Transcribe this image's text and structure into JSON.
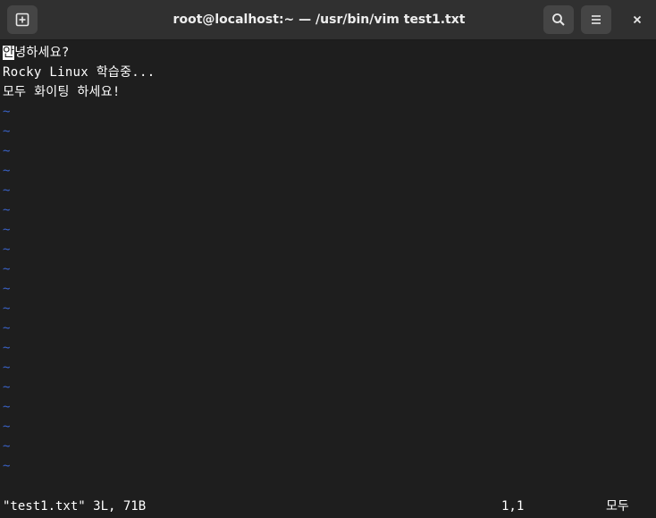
{
  "window": {
    "title": "root@localhost:~ — /usr/bin/vim test1.txt",
    "new_tab_icon": "new-tab-icon",
    "search_icon": "search-icon",
    "menu_icon": "hamburger-menu-icon",
    "close_icon": "close-icon"
  },
  "editor": {
    "lines": [
      {
        "cursor_char": "안",
        "rest": "녕하세요?"
      },
      {
        "text": "Rocky Linux 학습중..."
      },
      {
        "text": "모두 화이팅 하세요!"
      }
    ],
    "empty_line_marker": "~",
    "empty_line_count": 19,
    "colors": {
      "background": "#1e1e1e",
      "text": "#ffffff",
      "tilde": "#3a62c7",
      "titlebar": "#303030"
    }
  },
  "statusline": {
    "file_info": "\"test1.txt\" 3L, 71B",
    "cursor_position": "1,1",
    "scroll_position": "모두"
  }
}
